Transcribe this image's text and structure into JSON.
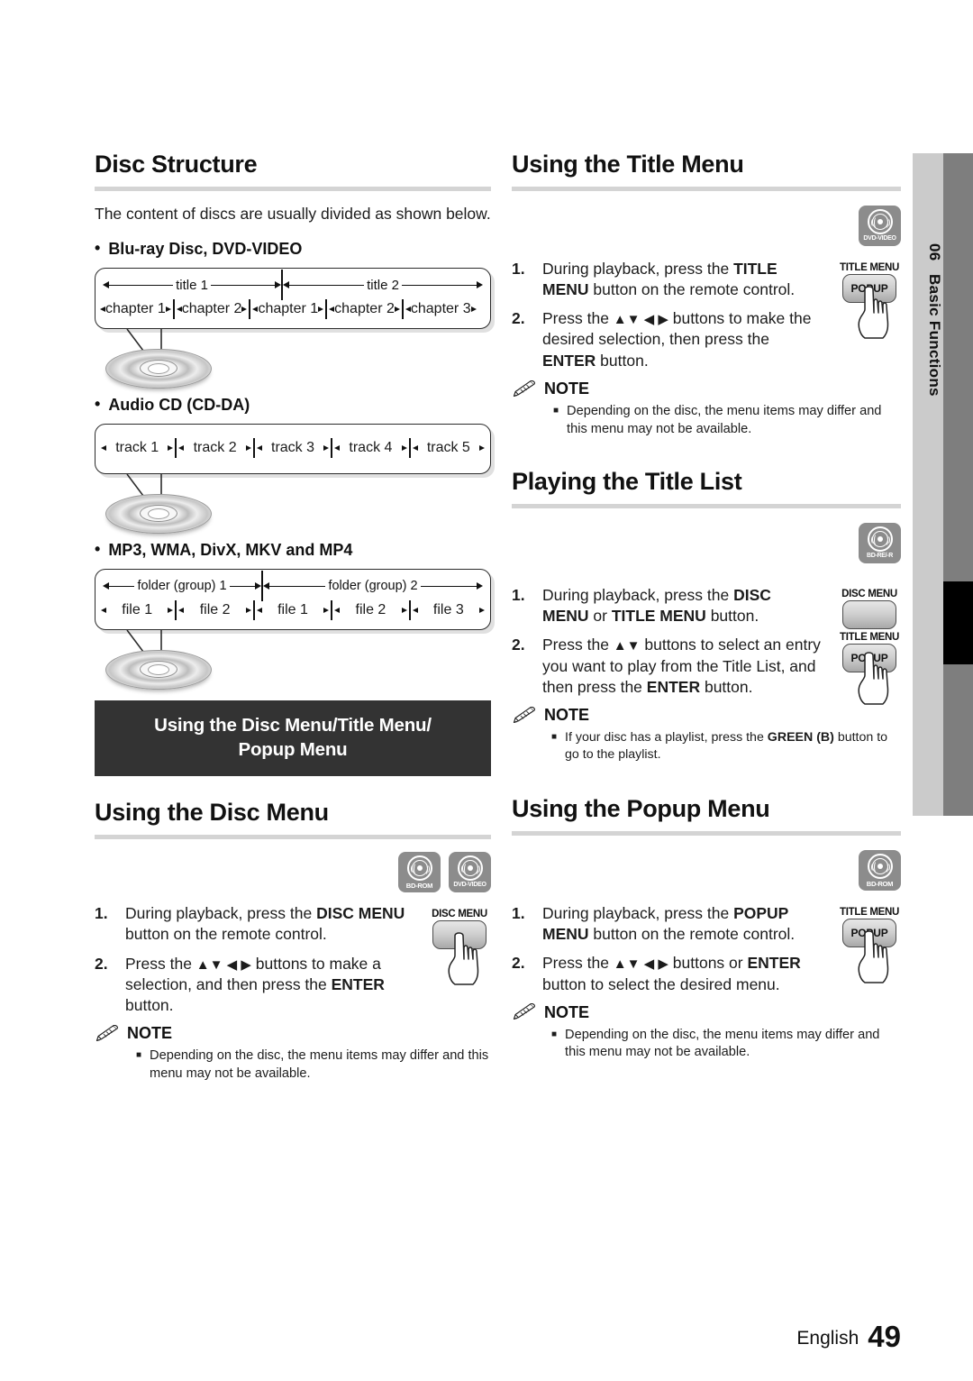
{
  "page": {
    "language": "English",
    "number": "49"
  },
  "chapter_tab": {
    "number": "06",
    "name": "Basic Functions"
  },
  "left_column": {
    "disc_structure": {
      "heading": "Disc Structure",
      "intro": "The content of discs are usually divided as shown below.",
      "groups": [
        {
          "bullet": "•",
          "label": "Blu-ray Disc, DVD-VIDEO",
          "titles": [
            "title 1",
            "title 2"
          ],
          "chapters": [
            "chapter 1",
            "chapter 2",
            "chapter 1",
            "chapter 2",
            "chapter 3"
          ]
        },
        {
          "bullet": "•",
          "label": "Audio CD (CD-DA)",
          "tracks": [
            "track 1",
            "track 2",
            "track 3",
            "track 4",
            "track 5"
          ]
        },
        {
          "bullet": "•",
          "label": "MP3, WMA, DivX, MKV and MP4",
          "folders": [
            "folder (group) 1",
            "folder (group) 2"
          ],
          "files": [
            "file 1",
            "file 2",
            "file 1",
            "file 2",
            "file 3"
          ]
        }
      ]
    },
    "banner": {
      "line1": "Using the Disc Menu/Title Menu/",
      "line2": "Popup Menu"
    },
    "disc_menu": {
      "heading": "Using the Disc Menu",
      "badges": [
        {
          "caption": "BD-ROM",
          "icon": "disc-icon"
        },
        {
          "caption": "DVD-VIDEO",
          "icon": "disc-icon"
        }
      ],
      "key": {
        "label": "DISC MENU",
        "text": ""
      },
      "steps": [
        {
          "num": "1.",
          "parts": [
            {
              "t": "During playback, press the ",
              "b": false
            },
            {
              "t": "DISC MENU",
              "b": true
            },
            {
              "t": " button on the remote control.",
              "b": false
            }
          ]
        },
        {
          "num": "2.",
          "parts": [
            {
              "t": "Press the ",
              "b": false
            },
            {
              "t": "▲▼ ◀ ▶",
              "b": false,
              "arrows": true
            },
            {
              "t": " buttons to make a selection, and then press the ",
              "b": false
            },
            {
              "t": "ENTER",
              "b": true
            },
            {
              "t": " button.",
              "b": false
            }
          ]
        }
      ],
      "note": {
        "label": "NOTE",
        "items": [
          [
            {
              "t": "Depending on the disc, the menu items may differ and this menu may not be available.",
              "b": false
            }
          ]
        ]
      }
    }
  },
  "right_column": {
    "title_menu": {
      "heading": "Using the Title Menu",
      "badges": [
        {
          "caption": "DVD-VIDEO",
          "icon": "disc-icon"
        }
      ],
      "key": {
        "label": "TITLE MENU",
        "text": "POPUP"
      },
      "steps": [
        {
          "num": "1.",
          "parts": [
            {
              "t": "During playback, press the ",
              "b": false
            },
            {
              "t": "TITLE MENU",
              "b": true
            },
            {
              "t": " button on the remote control.",
              "b": false
            }
          ]
        },
        {
          "num": "2.",
          "parts": [
            {
              "t": "Press the ",
              "b": false
            },
            {
              "t": "▲▼ ◀ ▶",
              "b": false,
              "arrows": true
            },
            {
              "t": " buttons to make the desired selection, then press the ",
              "b": false
            },
            {
              "t": "ENTER",
              "b": true
            },
            {
              "t": " button.",
              "b": false
            }
          ]
        }
      ],
      "note": {
        "label": "NOTE",
        "items": [
          [
            {
              "t": "Depending on the disc, the menu items may differ and this menu may not be available.",
              "b": false
            }
          ]
        ]
      }
    },
    "title_list": {
      "heading": "Playing the Title List",
      "badges": [
        {
          "caption": "BD-RE/-R",
          "icon": "disc-icon"
        }
      ],
      "keys": [
        {
          "label": "DISC MENU",
          "text": ""
        },
        {
          "label": "TITLE MENU",
          "text": "POPUP"
        }
      ],
      "steps": [
        {
          "num": "1.",
          "parts": [
            {
              "t": "During playback, press the ",
              "b": false
            },
            {
              "t": "DISC MENU",
              "b": true
            },
            {
              "t": " or ",
              "b": false
            },
            {
              "t": "TITLE MENU",
              "b": true
            },
            {
              "t": " button.",
              "b": false
            }
          ]
        },
        {
          "num": "2.",
          "parts": [
            {
              "t": "Press the ",
              "b": false
            },
            {
              "t": "▲▼",
              "b": false,
              "arrows": true
            },
            {
              "t": " buttons to select an entry you want to play from the Title List, and then press the ",
              "b": false
            },
            {
              "t": "ENTER",
              "b": true
            },
            {
              "t": " button.",
              "b": false
            }
          ]
        }
      ],
      "note": {
        "label": "NOTE",
        "items": [
          [
            {
              "t": "If your disc has a playlist, press the ",
              "b": false
            },
            {
              "t": "GREEN (B)",
              "b": true
            },
            {
              "t": " button to go to the playlist.",
              "b": false
            }
          ]
        ]
      }
    },
    "popup_menu": {
      "heading": "Using the Popup Menu",
      "badges": [
        {
          "caption": "BD-ROM",
          "icon": "disc-icon"
        }
      ],
      "key": {
        "label": "TITLE MENU",
        "text": "POPUP"
      },
      "steps": [
        {
          "num": "1.",
          "parts": [
            {
              "t": "During playback, press the ",
              "b": false
            },
            {
              "t": "POPUP MENU",
              "b": true
            },
            {
              "t": " button on the remote control.",
              "b": false
            }
          ]
        },
        {
          "num": "2.",
          "parts": [
            {
              "t": "Press the ",
              "b": false
            },
            {
              "t": "▲▼ ◀ ▶",
              "b": false,
              "arrows": true
            },
            {
              "t": " buttons or ",
              "b": false
            },
            {
              "t": "ENTER",
              "b": true
            },
            {
              "t": " button to select the desired menu.",
              "b": false
            }
          ]
        }
      ],
      "note": {
        "label": "NOTE",
        "items": [
          [
            {
              "t": "Depending on the disc, the menu items may differ and this menu may not be available.",
              "b": false
            }
          ]
        ]
      }
    }
  },
  "colors": {
    "banner_bg": "#333333",
    "tab_light": "#cbcbcb",
    "tab_dark": "#7e7e7e",
    "badge_bg": "#8c8c8c",
    "rule": "#d4d4d4"
  }
}
